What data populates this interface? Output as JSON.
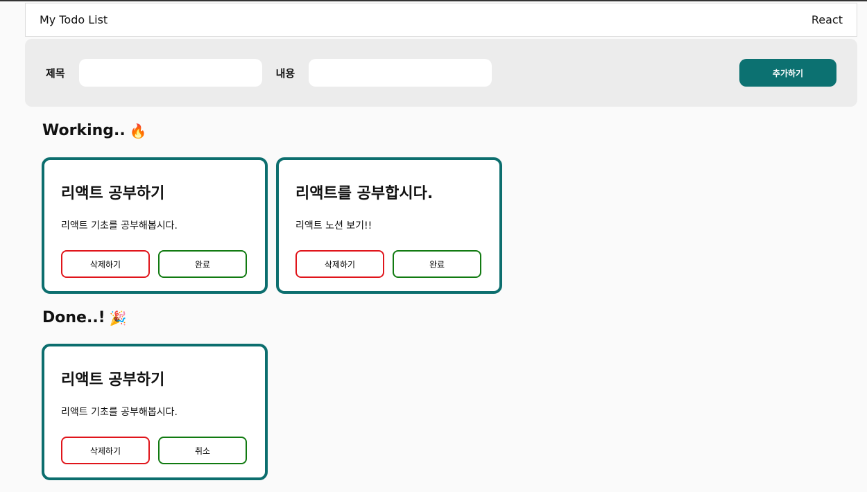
{
  "header": {
    "title": "My Todo List",
    "right": "React"
  },
  "form": {
    "title_label": "제목",
    "title_value": "",
    "content_label": "내용",
    "content_value": "",
    "add_button": "추가하기"
  },
  "working": {
    "title": "Working..",
    "emoji": "🔥",
    "cards": [
      {
        "title": "리액트 공부하기",
        "body": "리액트 기초를 공부해봅시다.",
        "delete_label": "삭제하기",
        "toggle_label": "완료"
      },
      {
        "title": "리액트를 공부합시다.",
        "body": "리액트 노션 보기!!",
        "delete_label": "삭제하기",
        "toggle_label": "완료"
      }
    ]
  },
  "done": {
    "title": "Done..!",
    "emoji": "🎉",
    "cards": [
      {
        "title": "리액트 공부하기",
        "body": "리액트 기초를 공부해봅시다.",
        "delete_label": "삭제하기",
        "toggle_label": "취소"
      }
    ]
  },
  "colors": {
    "accent": "#0c7171",
    "delete_border": "#e0151b",
    "complete_border": "#117a11"
  }
}
